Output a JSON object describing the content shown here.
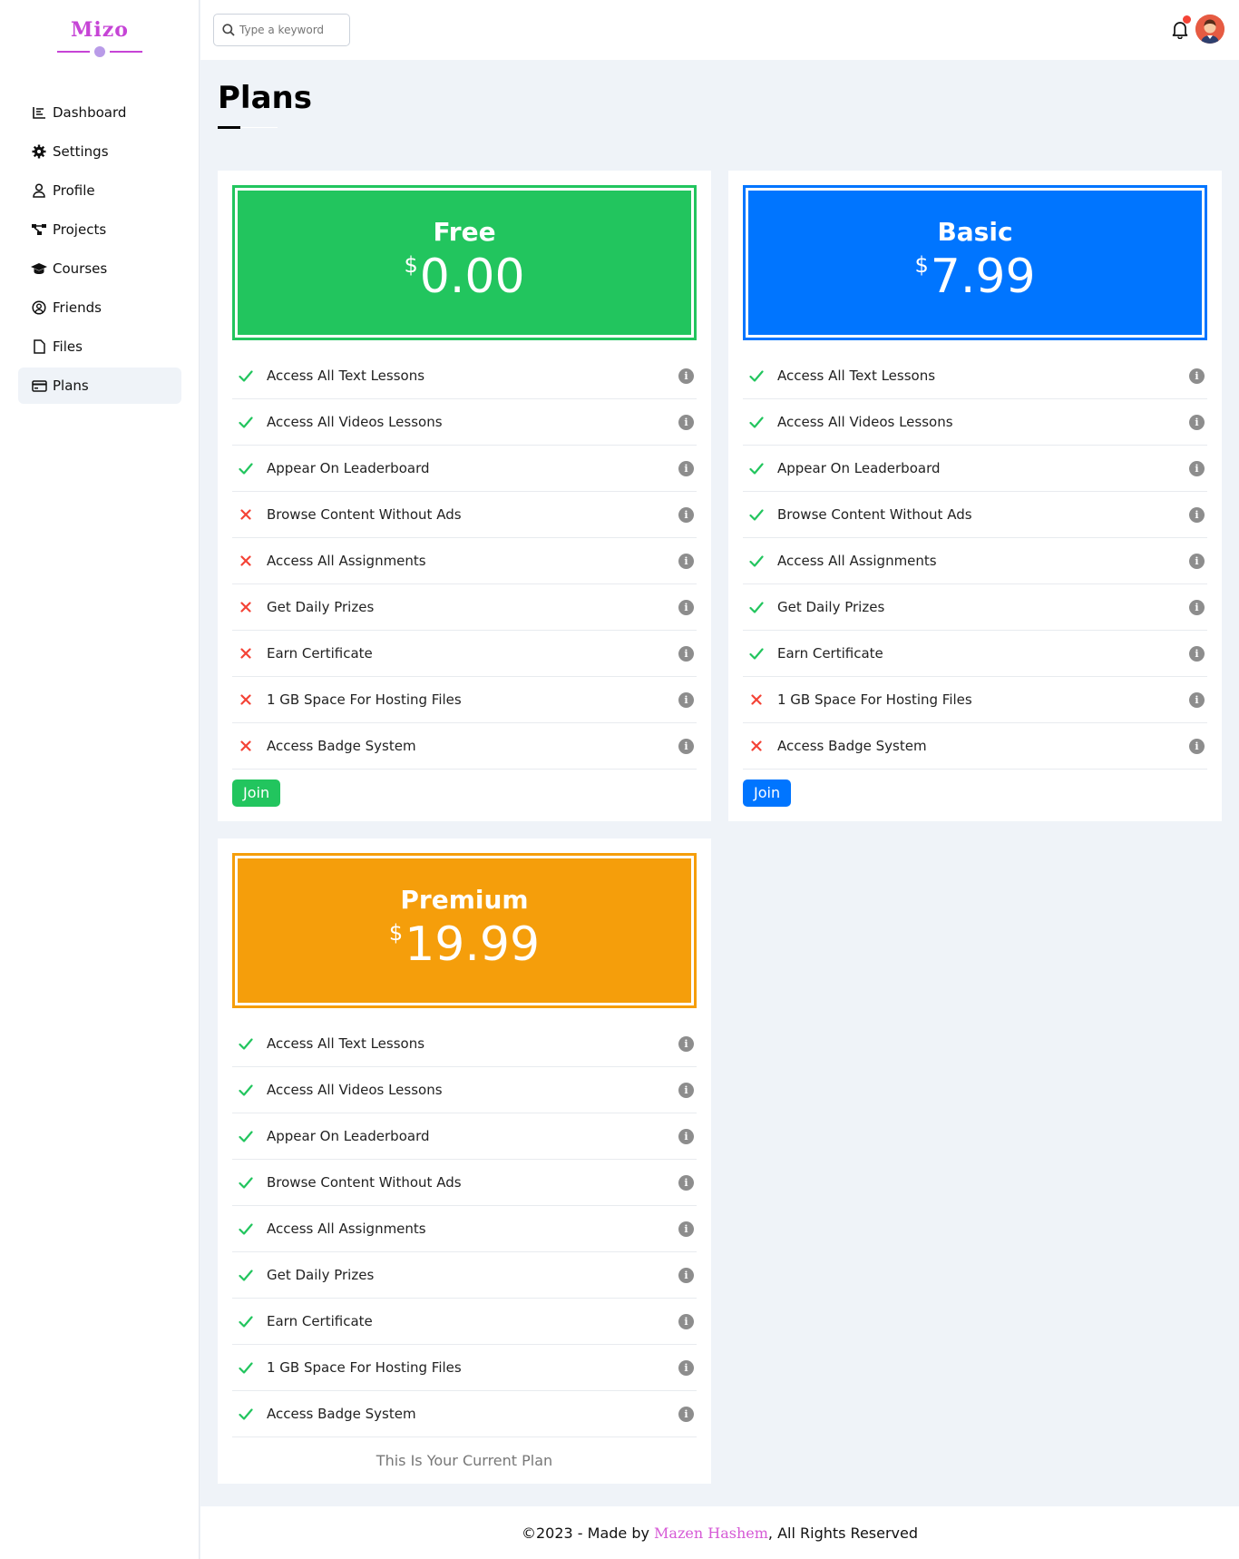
{
  "app": {
    "logo": "Mizo"
  },
  "sidebar": {
    "items": [
      {
        "label": "Dashboard",
        "icon": "chart-line-icon"
      },
      {
        "label": "Settings",
        "icon": "gear-icon"
      },
      {
        "label": "Profile",
        "icon": "user-icon"
      },
      {
        "label": "Projects",
        "icon": "diagram-project-icon"
      },
      {
        "label": "Courses",
        "icon": "graduation-cap-icon"
      },
      {
        "label": "Friends",
        "icon": "user-circle-icon"
      },
      {
        "label": "Files",
        "icon": "file-icon"
      },
      {
        "label": "Plans",
        "icon": "credit-card-icon",
        "active": true
      }
    ]
  },
  "header": {
    "search": {
      "placeholder": "Type a keyword"
    }
  },
  "page": {
    "title": "Plans"
  },
  "plans": [
    {
      "name": "Free",
      "currency": "$",
      "price": "0.00",
      "color": "#22c55e",
      "features": [
        {
          "label": "Access All Text Lessons",
          "included": true
        },
        {
          "label": "Access All Videos Lessons",
          "included": true
        },
        {
          "label": "Appear On Leaderboard",
          "included": true
        },
        {
          "label": "Browse Content Without Ads",
          "included": false
        },
        {
          "label": "Access All Assignments",
          "included": false
        },
        {
          "label": "Get Daily Prizes",
          "included": false
        },
        {
          "label": "Earn Certificate",
          "included": false
        },
        {
          "label": "1 GB Space For Hosting Files",
          "included": false
        },
        {
          "label": "Access Badge System",
          "included": false
        }
      ],
      "action": "Join"
    },
    {
      "name": "Basic",
      "currency": "$",
      "price": "7.99",
      "color": "#0075ff",
      "features": [
        {
          "label": "Access All Text Lessons",
          "included": true
        },
        {
          "label": "Access All Videos Lessons",
          "included": true
        },
        {
          "label": "Appear On Leaderboard",
          "included": true
        },
        {
          "label": "Browse Content Without Ads",
          "included": true
        },
        {
          "label": "Access All Assignments",
          "included": true
        },
        {
          "label": "Get Daily Prizes",
          "included": true
        },
        {
          "label": "Earn Certificate",
          "included": true
        },
        {
          "label": "1 GB Space For Hosting Files",
          "included": false
        },
        {
          "label": "Access Badge System",
          "included": false
        }
      ],
      "action": "Join"
    },
    {
      "name": "Premium",
      "currency": "$",
      "price": "19.99",
      "color": "#f59e0b",
      "features": [
        {
          "label": "Access All Text Lessons",
          "included": true
        },
        {
          "label": "Access All Videos Lessons",
          "included": true
        },
        {
          "label": "Appear On Leaderboard",
          "included": true
        },
        {
          "label": "Browse Content Without Ads",
          "included": true
        },
        {
          "label": "Access All Assignments",
          "included": true
        },
        {
          "label": "Get Daily Prizes",
          "included": true
        },
        {
          "label": "Earn Certificate",
          "included": true
        },
        {
          "label": "1 GB Space For Hosting Files",
          "included": true
        },
        {
          "label": "Access Badge System",
          "included": true
        }
      ],
      "current_plan_text": "This Is Your Current Plan"
    }
  ],
  "colors": {
    "check": "#22c55e",
    "cross": "#f44336",
    "accent": "#c644d6"
  },
  "footer": {
    "prefix": "©2023 - Made by ",
    "author": "Mazen Hashem",
    "suffix": ", All Rights Reserved"
  }
}
